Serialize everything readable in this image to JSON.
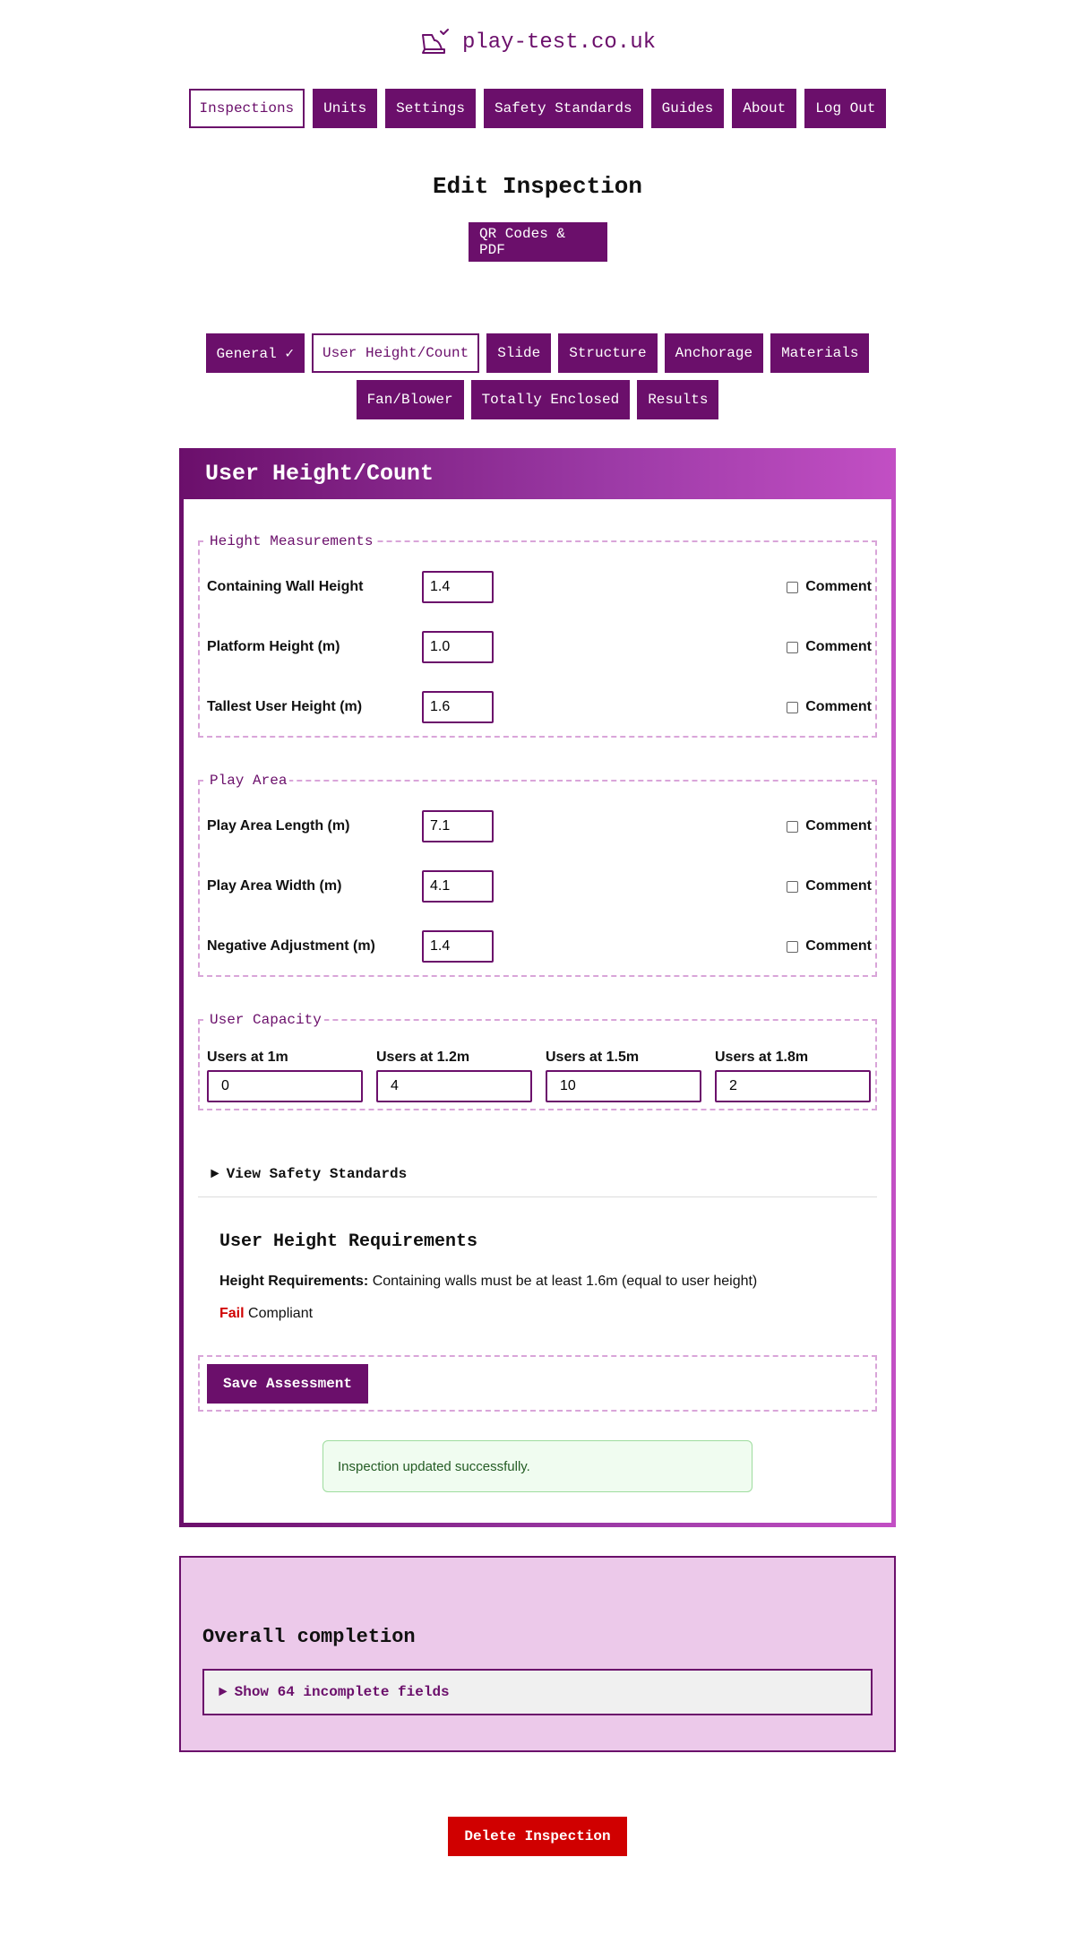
{
  "site": {
    "title": "play-test.co.uk",
    "logo_icon": "inflatable-slide-icon"
  },
  "nav": {
    "items": [
      "Inspections",
      "Units",
      "Settings",
      "Safety Standards",
      "Guides",
      "About",
      "Log Out"
    ],
    "active": "Inspections"
  },
  "page": {
    "title": "Edit Inspection",
    "qr_button": "QR Codes & PDF"
  },
  "tabs": {
    "items": [
      "General ✓",
      "User Height/Count",
      "Slide",
      "Structure",
      "Anchorage",
      "Materials",
      "Fan/Blower",
      "Totally Enclosed",
      "Results"
    ],
    "active": "User Height/Count"
  },
  "panel": {
    "title": "User Height/Count",
    "groups": {
      "height": {
        "legend": "Height Measurements",
        "rows": [
          {
            "label": "Containing Wall Height",
            "value": "1.4",
            "comment_label": "Comment"
          },
          {
            "label": "Platform Height (m)",
            "value": "1.0",
            "comment_label": "Comment"
          },
          {
            "label": "Tallest User Height (m)",
            "value": "1.6",
            "comment_label": "Comment"
          }
        ]
      },
      "play_area": {
        "legend": "Play Area",
        "rows": [
          {
            "label": "Play Area Length (m)",
            "value": "7.1",
            "comment_label": "Comment"
          },
          {
            "label": "Play Area Width (m)",
            "value": "4.1",
            "comment_label": "Comment"
          },
          {
            "label": "Negative Adjustment (m)",
            "value": "1.4",
            "comment_label": "Comment"
          }
        ]
      },
      "capacity": {
        "legend": "User Capacity",
        "cols": [
          {
            "label": "Users at 1m",
            "value": "0"
          },
          {
            "label": "Users at 1.2m",
            "value": "4"
          },
          {
            "label": "Users at 1.5m",
            "value": "10"
          },
          {
            "label": "Users at 1.8m",
            "value": "2"
          }
        ]
      }
    },
    "safety_standards_toggle": "View Safety Standards",
    "requirements": {
      "title": "User Height Requirements",
      "label": "Height Requirements:",
      "text": " Containing walls must be at least 1.6m (equal to user height)",
      "status": "Fail",
      "status_suffix": " Compliant"
    },
    "save_button": "Save Assessment",
    "flash": "Inspection updated successfully."
  },
  "completion": {
    "title": "Overall completion",
    "toggle": "Show 64 incomplete fields"
  },
  "delete_button": "Delete Inspection",
  "colors": {
    "brand": "#6b0f6b",
    "brand_light": "#c24fc4",
    "danger": "#d00000",
    "completion_bg": "#ecc9ea"
  }
}
